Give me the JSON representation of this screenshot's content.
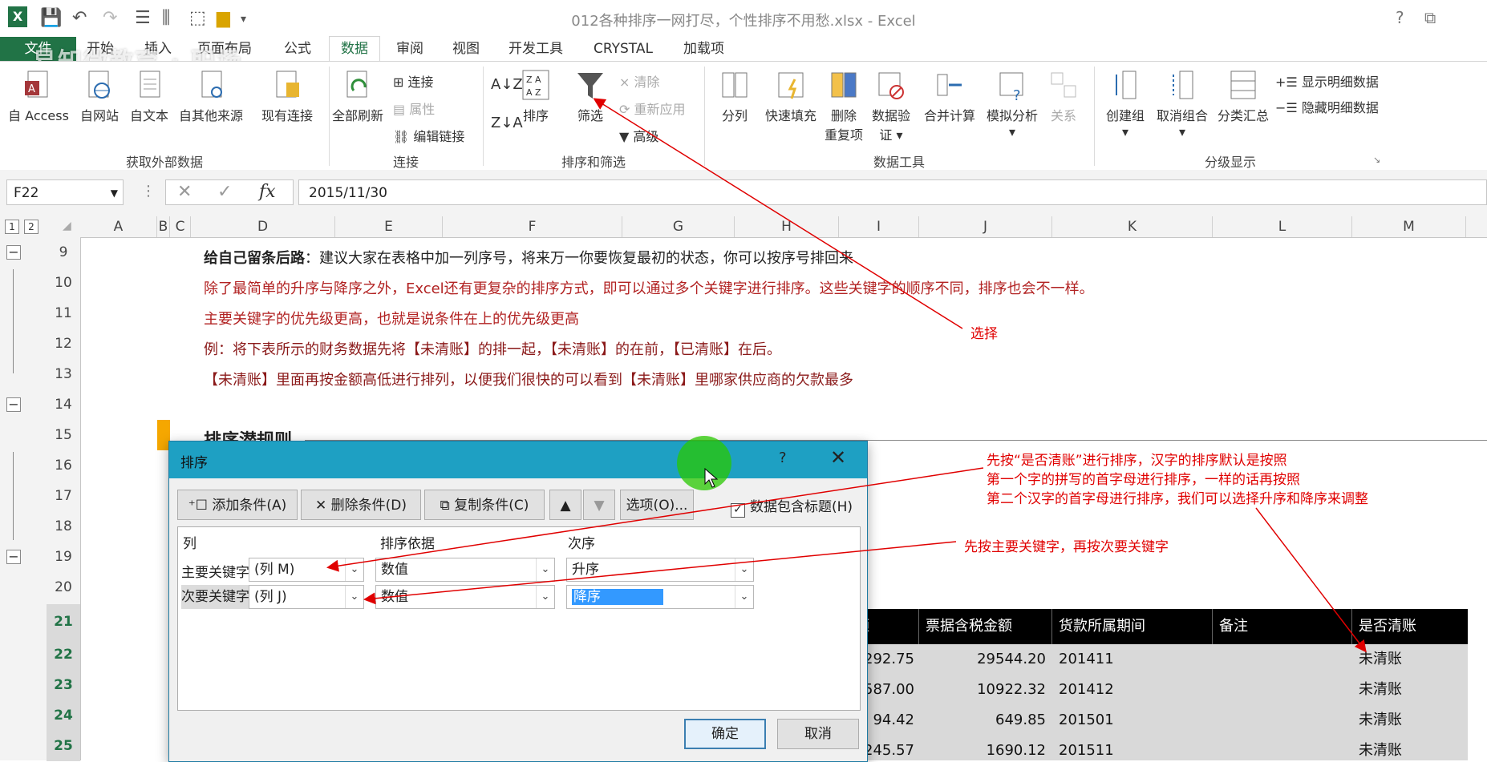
{
  "window": {
    "title": "012各种排序一网打尽，个性排序不用愁.xlsx - Excel",
    "help": "?",
    "controls": [
      "⧉",
      "—",
      "☐",
      "✕"
    ]
  },
  "watermark": "易知微教育 · 职场",
  "tabs": {
    "file": "文件",
    "items": [
      "开始",
      "插入",
      "页面布局",
      "公式",
      "数据",
      "审阅",
      "视图",
      "开发工具",
      "CRYSTAL",
      "加载项"
    ],
    "active": "数据"
  },
  "ribbon": {
    "groups": {
      "external": "获取外部数据",
      "connections": "连接",
      "sort_filter": "排序和筛选",
      "data_tools": "数据工具",
      "outline": "分级显示"
    },
    "buttons": {
      "access": "自 Access",
      "web": "自网站",
      "text": "自文本",
      "other": "自其他来源",
      "existing": "现有连接",
      "refresh_all": "全部刷新",
      "connections": "连接",
      "properties": "属性",
      "edit_links": "编辑链接",
      "sort": "排序",
      "filter": "筛选",
      "clear": "清除",
      "reapply": "重新应用",
      "advanced": "高级",
      "split": "分列",
      "flash_fill": "快速填充",
      "remove_dup_1": "删除",
      "remove_dup_2": "重复项",
      "validation_1": "数据验",
      "validation_2": "证",
      "consolidate": "合并计算",
      "what_if": "模拟分析",
      "relationships": "关系",
      "group": "创建组",
      "ungroup": "取消组合",
      "subtotal": "分类汇总",
      "show_detail": "显示明细数据",
      "hide_detail": "隐藏明细数据"
    }
  },
  "formula_bar": {
    "name_box": "F22",
    "formula": "2015/11/30"
  },
  "columns": [
    "A",
    "B",
    "C",
    "D",
    "E",
    "F",
    "G",
    "H",
    "I",
    "J",
    "K",
    "L",
    "M"
  ],
  "outline_levels": [
    "1",
    "2"
  ],
  "rows": [
    "9",
    "10",
    "11",
    "12",
    "13",
    "14",
    "15",
    "16",
    "17",
    "18",
    "19",
    "20",
    "21",
    "22",
    "23",
    "24",
    "25"
  ],
  "sheet": {
    "line9_bold": "给自己留条后路",
    "line9_rest": "：建议大家在表格中加一列序号，将来万一你要恢复最初的状态，你可以按序号排回来",
    "line10": "除了最简单的升序与降序之外，Excel还有更复杂的排序方式，即可以通过多个关键字进行排序。这些关键字的顺序不同，排序也会不一样。",
    "line11": "主要关键字的优先级更高，也就是说条件在上的优先级更高",
    "line12": "例：将下表所示的财务数据先将【未清账】的排一起，【未清账】的在前，【已清账】在后。",
    "line13": "【未清账】里面再按金额高低进行排列，以便我们很快的可以看到【未清账】里哪家供应商的欠款最多",
    "section_title": "排序潜规则"
  },
  "table": {
    "headers": [
      "额",
      "票据含税金额",
      "货款所属期间",
      "备注",
      "是否清账"
    ],
    "rows": [
      [
        "292.75",
        "29544.20",
        "201411",
        "",
        "未清账"
      ],
      [
        "587.00",
        "10922.32",
        "201412",
        "",
        "未清账"
      ],
      [
        "94.42",
        "649.85",
        "201501",
        "",
        "未清账"
      ],
      [
        "245.57",
        "1690.12",
        "201511",
        "",
        "未清账"
      ]
    ]
  },
  "dialog": {
    "title": "排序",
    "help": "?",
    "add": "添加条件(A)",
    "delete": "删除条件(D)",
    "copy": "复制条件(C)",
    "options": "选项(O)...",
    "has_header": "数据包含标题(H)",
    "col_header": "列",
    "basis_header": "排序依据",
    "order_header": "次序",
    "primary": {
      "label": "主要关键字",
      "column": "(列 M)",
      "basis": "数值",
      "order": "升序"
    },
    "secondary": {
      "label": "次要关键字",
      "column": "(列 J)",
      "basis": "数值",
      "order": "降序"
    },
    "ok": "确定",
    "cancel": "取消"
  },
  "annotations": {
    "select": "选择",
    "note1": "先按“是否清账”进行排序，汉字的排序默认是按照",
    "note2": "第一个字的拼写的首字母进行排序，一样的话再按照",
    "note3": "第二个汉字的首字母进行排序，我们可以选择升序和降序来调整",
    "note4": "先按主要关键字，再按次要关键字",
    "color": "#e00000"
  }
}
